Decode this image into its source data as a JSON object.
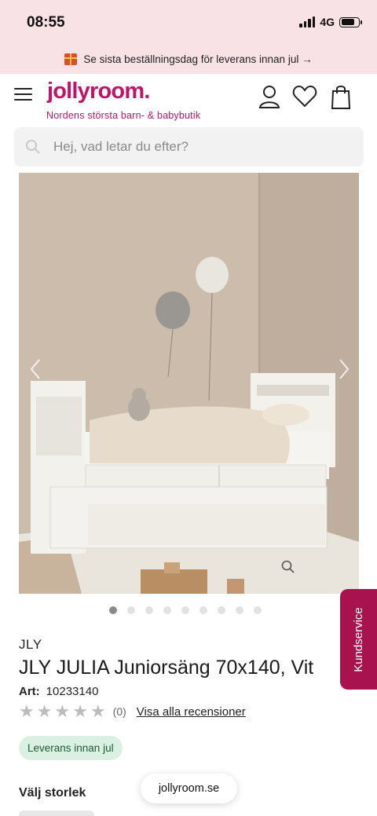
{
  "status_bar": {
    "time": "08:55",
    "network": "4G"
  },
  "promo": {
    "text": "Se sista beställningsdag för leverans innan jul →",
    "icon": "gift-icon"
  },
  "header": {
    "logo": "jollyroom.",
    "tagline": "Nordens största barn- & babybutik",
    "icons": [
      "menu-icon",
      "user-icon",
      "heart-icon",
      "shopping-bag-icon"
    ],
    "brand_color": "#c0136a"
  },
  "search": {
    "placeholder": "Hej, vad letar du efter?",
    "value": ""
  },
  "gallery": {
    "image_count": 9,
    "active_index": 0
  },
  "side_tab": {
    "label": "Kundservice",
    "color": "#a8124f"
  },
  "product": {
    "brand": "JLY",
    "title": "JLY JULIA Juniorsäng 70x140, Vit",
    "art_label": "Art:",
    "art_number": "10233140",
    "rating_stars": 0,
    "rating_count": "(0)",
    "reviews_link": "Visa alla recensioner",
    "badge": "Leverans innan jul",
    "size_label": "Välj storlek"
  },
  "browser": {
    "url": "jollyroom.se"
  }
}
